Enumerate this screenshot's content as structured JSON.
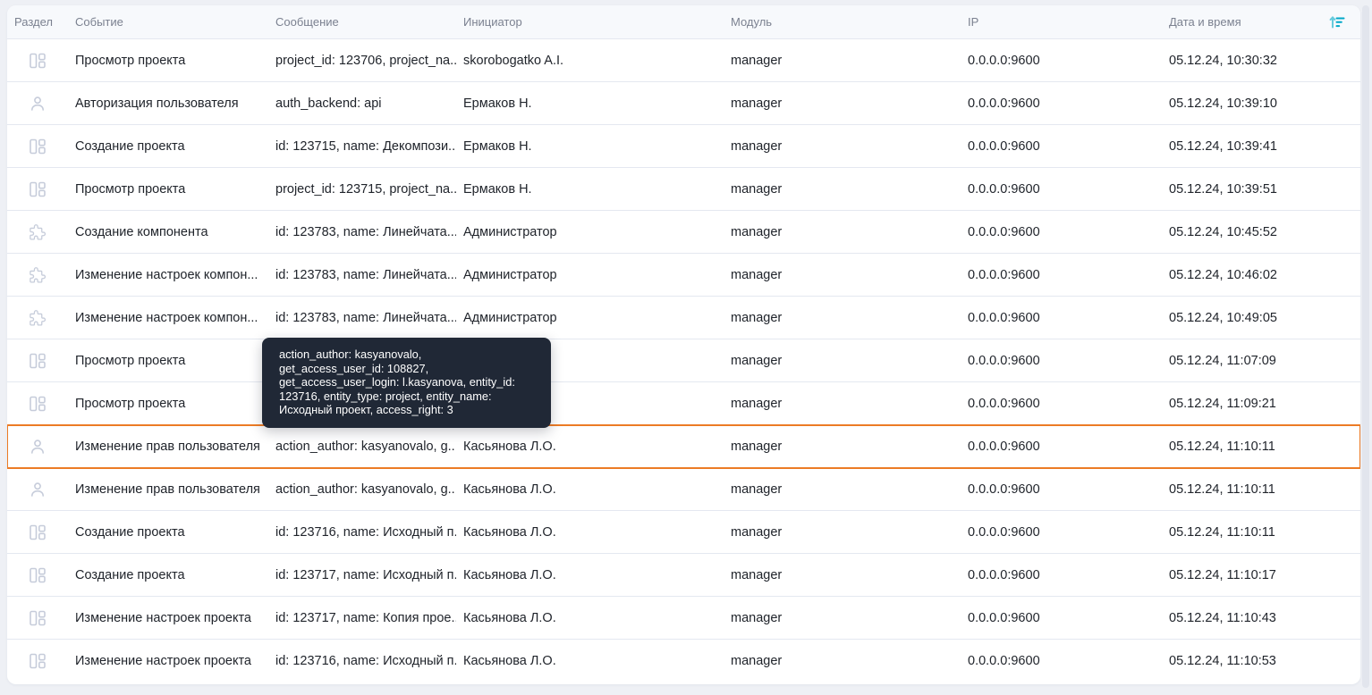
{
  "table": {
    "columns": [
      {
        "key": "section",
        "label": "Раздел"
      },
      {
        "key": "event",
        "label": "Событие"
      },
      {
        "key": "message",
        "label": "Сообщение"
      },
      {
        "key": "initiator",
        "label": "Инициатор"
      },
      {
        "key": "module",
        "label": "Модуль"
      },
      {
        "key": "ip",
        "label": "IP"
      },
      {
        "key": "datetime",
        "label": "Дата и время"
      }
    ],
    "rows": [
      {
        "icon": "project",
        "event": "Просмотр проекта",
        "message": "project_id: 123706, project_na...",
        "initiator": "skorobogatko A.I.",
        "module": "manager",
        "ip": "0.0.0.0:9600",
        "datetime": "05.12.24, 10:30:32",
        "highlighted": false
      },
      {
        "icon": "user",
        "event": "Авторизация пользователя",
        "message": "auth_backend: api",
        "initiator": "Ермаков Н.",
        "module": "manager",
        "ip": "0.0.0.0:9600",
        "datetime": "05.12.24, 10:39:10",
        "highlighted": false
      },
      {
        "icon": "project",
        "event": "Создание проекта",
        "message": "id: 123715, name: Декомпози...",
        "initiator": "Ермаков Н.",
        "module": "manager",
        "ip": "0.0.0.0:9600",
        "datetime": "05.12.24, 10:39:41",
        "highlighted": false
      },
      {
        "icon": "project",
        "event": "Просмотр проекта",
        "message": "project_id: 123715, project_na...",
        "initiator": "Ермаков Н.",
        "module": "manager",
        "ip": "0.0.0.0:9600",
        "datetime": "05.12.24, 10:39:51",
        "highlighted": false
      },
      {
        "icon": "component",
        "event": "Создание компонента",
        "message": "id: 123783, name: Линейчата...",
        "initiator": "Администратор",
        "module": "manager",
        "ip": "0.0.0.0:9600",
        "datetime": "05.12.24, 10:45:52",
        "highlighted": false
      },
      {
        "icon": "component",
        "event": "Изменение настроек компон...",
        "message": "id: 123783, name: Линейчата...",
        "initiator": "Администратор",
        "module": "manager",
        "ip": "0.0.0.0:9600",
        "datetime": "05.12.24, 10:46:02",
        "highlighted": false
      },
      {
        "icon": "component",
        "event": "Изменение настроек компон...",
        "message": "id: 123783, name: Линейчата...",
        "initiator": "Администратор",
        "module": "manager",
        "ip": "0.0.0.0:9600",
        "datetime": "05.12.24, 10:49:05",
        "highlighted": false
      },
      {
        "icon": "project",
        "event": "Просмотр проекта",
        "message": "",
        "initiator": "",
        "module": "manager",
        "ip": "0.0.0.0:9600",
        "datetime": "05.12.24, 11:07:09",
        "highlighted": false
      },
      {
        "icon": "project",
        "event": "Просмотр проекта",
        "message": "",
        "initiator": "",
        "module": "manager",
        "ip": "0.0.0.0:9600",
        "datetime": "05.12.24, 11:09:21",
        "highlighted": false
      },
      {
        "icon": "user",
        "event": "Изменение прав пользователя",
        "message": "action_author: kasyanovalo, g...",
        "initiator": "Касьянова Л.О.",
        "module": "manager",
        "ip": "0.0.0.0:9600",
        "datetime": "05.12.24, 11:10:11",
        "highlighted": true
      },
      {
        "icon": "user",
        "event": "Изменение прав пользователя",
        "message": "action_author: kasyanovalo, g...",
        "initiator": "Касьянова Л.О.",
        "module": "manager",
        "ip": "0.0.0.0:9600",
        "datetime": "05.12.24, 11:10:11",
        "highlighted": false
      },
      {
        "icon": "project",
        "event": "Создание проекта",
        "message": "id: 123716, name: Исходный п...",
        "initiator": "Касьянова Л.О.",
        "module": "manager",
        "ip": "0.0.0.0:9600",
        "datetime": "05.12.24, 11:10:11",
        "highlighted": false
      },
      {
        "icon": "project",
        "event": "Создание проекта",
        "message": "id: 123717, name: Исходный п...",
        "initiator": "Касьянова Л.О.",
        "module": "manager",
        "ip": "0.0.0.0:9600",
        "datetime": "05.12.24, 11:10:17",
        "highlighted": false
      },
      {
        "icon": "project",
        "event": "Изменение настроек проекта",
        "message": "id: 123717, name: Копия прое...",
        "initiator": "Касьянова Л.О.",
        "module": "manager",
        "ip": "0.0.0.0:9600",
        "datetime": "05.12.24, 11:10:43",
        "highlighted": false
      },
      {
        "icon": "project",
        "event": "Изменение настроек проекта",
        "message": "id: 123716, name: Исходный п...",
        "initiator": "Касьянова Л.О.",
        "module": "manager",
        "ip": "0.0.0.0:9600",
        "datetime": "05.12.24, 11:10:53",
        "highlighted": false
      }
    ]
  },
  "tooltip": {
    "lines": [
      "action_author: kasyanovalo,",
      "get_access_user_id: 108827,",
      "get_access_user_login: l.kasyanova, entity_id:",
      "123716, entity_type: project, entity_name:",
      "Исходный проект, access_right: 3"
    ]
  },
  "icons": {
    "project": "project-icon",
    "user": "user-icon",
    "component": "component-puzzle-icon",
    "sort": "sort-ascending-icon"
  },
  "colors": {
    "highlight_border": "#ec7b25",
    "tooltip_background": "#202836",
    "sort_icon_arrow": "#66cbdd",
    "sort_icon_lines": "#00a8c8",
    "row_icon_stroke": "#c6ccda",
    "header_text": "#7b8190",
    "cell_text": "#20242b",
    "row_separator": "#e4e8f0",
    "header_background": "#f7f9fc",
    "page_background": "#eef0f5"
  }
}
